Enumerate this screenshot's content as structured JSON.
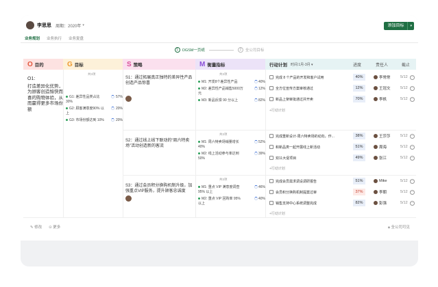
{
  "user": {
    "name": "李思思"
  },
  "period": {
    "label": "周期：2020年"
  },
  "add_goal": {
    "label": "添加目标",
    "menu": "▾"
  },
  "tabs": [
    "业务规划",
    "业务执行",
    "业务复盘"
  ],
  "steps": [
    {
      "num": "1",
      "label": "OGSM一页纸"
    },
    {
      "num": "2",
      "label": "全公司目标"
    }
  ],
  "headers": {
    "o": {
      "letter": "O",
      "label": "目的"
    },
    "g": {
      "letter": "G",
      "label": "目标"
    },
    "s": {
      "letter": "S",
      "label": "策略"
    },
    "m": {
      "letter": "M",
      "label": "衡量指标"
    },
    "plan": {
      "label": "行动计划",
      "filter": "时间:1月-3月 ▾",
      "progress": "进度",
      "owner": "责任人",
      "due": "截止"
    }
  },
  "objective": {
    "label": "O1:",
    "text": "打造差异化优势，为顾客创造愉快而喜的购物体验，从而赢得更多市场份额"
  },
  "goal": {
    "owner_tag": "共3项",
    "items": [
      {
        "text": "G1: 差异性品类占比 30%",
        "pct": "57%"
      },
      {
        "text": "G2: 顾客满意度90% 以上",
        "pct": "20%"
      },
      {
        "text": "G3: 市场份额达到 10%",
        "pct": "20%"
      }
    ]
  },
  "strategies": [
    {
      "text": "S1：通过拓展真正独特的差异性产品创造产品惊喜",
      "measure_tag": "共3项",
      "measures": [
        {
          "text": "M1: 开发8个差异性产品",
          "pct": "40%"
        },
        {
          "text": "M2: 差异性产品销售5000万元",
          "pct": "12%"
        },
        {
          "text": "M3: 新品反馈 90 分以上",
          "pct": "82%"
        }
      ],
      "plans": [
        {
          "text": "完成 8 个产品的开发和客户试用",
          "progress": "40%",
          "owner": "李常常",
          "due": "5/12"
        },
        {
          "text": "全方位宣传方案审核通过",
          "progress": "12%",
          "owner": "王冠文",
          "due": "5/12"
        },
        {
          "text": "新品上架审批通过并开卖",
          "progress": "70%",
          "owner": "李帆",
          "due": "5/12"
        }
      ]
    },
    {
      "text": "S2：通过线上线下联动的“周六特卖场”活动创造新的客流",
      "measure_tag": "共3项",
      "measures": [
        {
          "text": "M1: 周六特卖场销量增长 40%",
          "pct": "52%"
        },
        {
          "text": "M2: 线上活动参与率达到 50%",
          "pct": "39%"
        }
      ],
      "plans": [
        {
          "text": "完成重新设计-周六特卖场的动向，作...",
          "progress": "38%",
          "owner": "王莎莎",
          "due": "5/12"
        },
        {
          "text": "和新品类一起开展线上新活动",
          "progress": "51%",
          "owner": "周海",
          "due": "5/12"
        },
        {
          "text": "双11大促项目",
          "progress": "49%",
          "owner": "张江",
          "due": "5/12"
        }
      ]
    },
    {
      "text": "S3：通过会员积分换购机制升级，加强重点VIP服务，提升顾客忠诚度",
      "measure_tag": "共3项",
      "measures": [
        {
          "text": "M1: 重点 VIP 满意度调查 95% 以上",
          "pct": "46%"
        },
        {
          "text": "M2: 重点 VIP 回购率 95% 以上",
          "pct": "40%"
        }
      ],
      "plans": [
        {
          "text": "完成会员需求调设调研报告",
          "progress": "51%",
          "owner": "Mike",
          "due": "5/12"
        },
        {
          "text": "会员积分换购机制提案过审",
          "progress": "37%",
          "owner": "李朝",
          "due": "5/12"
        },
        {
          "text": "销售支持中心系统调整完成",
          "progress": "82%",
          "owner": "彭强",
          "due": "5/12"
        }
      ]
    }
  ],
  "add_plan_label": "+行动计划",
  "footer": {
    "edit": "修改",
    "more": "更多",
    "visibility": "全公司可见"
  }
}
